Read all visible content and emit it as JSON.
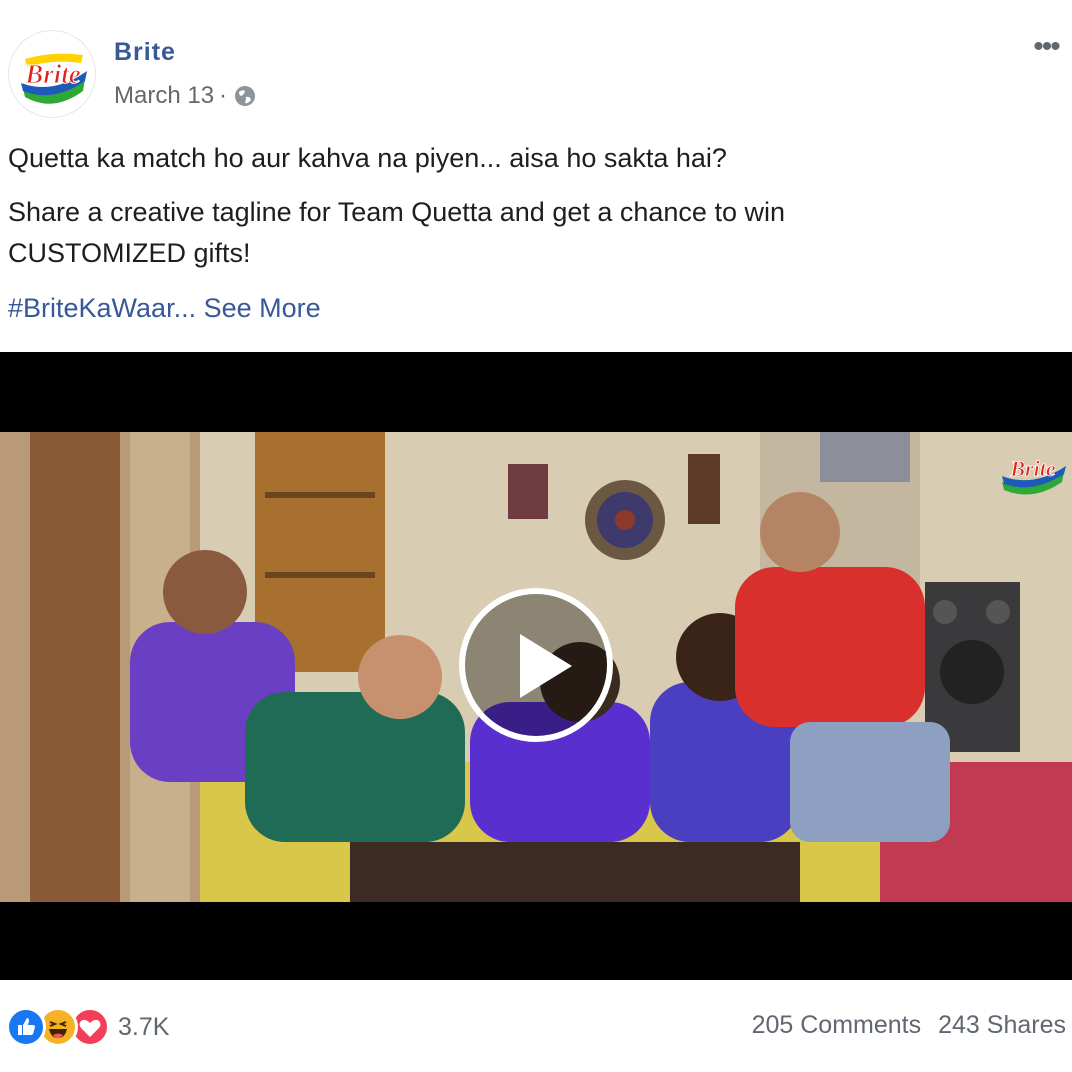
{
  "post": {
    "page_name": "Brite",
    "date": "March 13",
    "separator": "·",
    "privacy_icon": "globe-icon",
    "more_icon": "more-options-icon",
    "text_line1": "Quetta ka match ho aur kahva na piyen... aisa ho sakta hai?",
    "text_line2": "Share a creative tagline for Team Quetta and get a chance to win CUSTOMIZED gifts!",
    "hashtag": "#BriteKaWaar...",
    "see_more": "See More"
  },
  "logo": {
    "text": "Brite",
    "colors": {
      "red": "#e2231a",
      "yellow": "#ffd200",
      "green": "#2ea836",
      "blue": "#1e5bb8"
    }
  },
  "video": {
    "play_icon": "play-icon",
    "overlay_logo": "Brite"
  },
  "footer": {
    "reaction_icons": [
      "like-icon",
      "haha-icon",
      "love-icon"
    ],
    "reaction_count": "3.7K",
    "comments": "205 Comments",
    "shares": "243 Shares"
  },
  "colors": {
    "link": "#385898",
    "text": "#1c1e21",
    "muted": "#65676b",
    "like": "#1877f2",
    "haha": "#f7b125",
    "love": "#f33e58"
  }
}
